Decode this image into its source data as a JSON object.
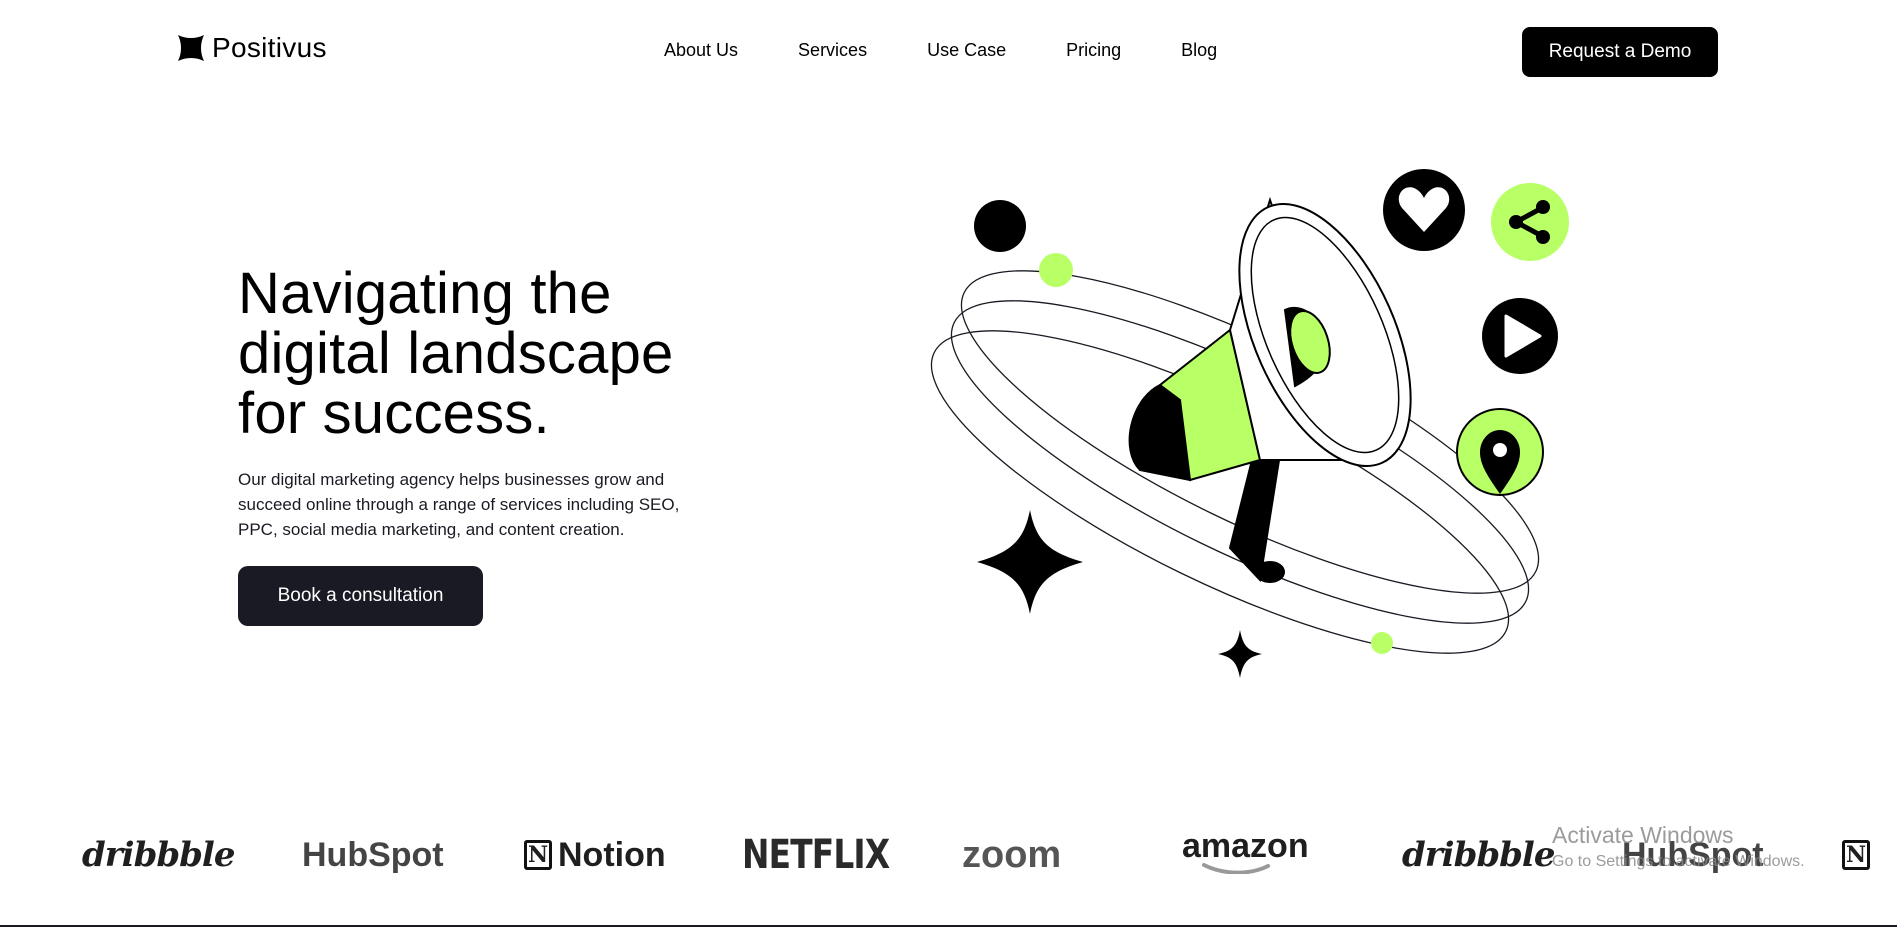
{
  "brand": {
    "name": "Positivus",
    "logo_icon": "asterisk-star-icon"
  },
  "nav": {
    "items": [
      {
        "label": "About Us"
      },
      {
        "label": "Services"
      },
      {
        "label": "Use Case"
      },
      {
        "label": "Pricing"
      },
      {
        "label": "Blog"
      }
    ],
    "cta_label": "Request a Demo"
  },
  "hero": {
    "title_line1": "Navigating the",
    "title_line2": "digital landscape",
    "title_line3": "for success.",
    "description": "Our digital marketing agency helps businesses grow and succeed online through a range of services including SEO, PPC, social media marketing, and content creation.",
    "cta_label": "Book a consultation",
    "illustration_icons": [
      "megaphone-icon",
      "heart-icon",
      "share-icon",
      "play-icon",
      "location-pin-icon",
      "sparkle-star-icon"
    ]
  },
  "partners": {
    "logos": [
      {
        "name": "dribbble"
      },
      {
        "name": "HubSpot"
      },
      {
        "name": "Notion"
      },
      {
        "name": "NETFLIX"
      },
      {
        "name": "zoom"
      },
      {
        "name": "amazon"
      },
      {
        "name": "dribbble"
      },
      {
        "name": "HubSpot"
      },
      {
        "name": "N"
      }
    ]
  },
  "system": {
    "watermark_title": "Activate Windows",
    "watermark_sub": "Go to Settings to activate Windows."
  },
  "colors": {
    "accent": "#b9ff66",
    "dark": "#191a23",
    "background": "#ffffff"
  }
}
